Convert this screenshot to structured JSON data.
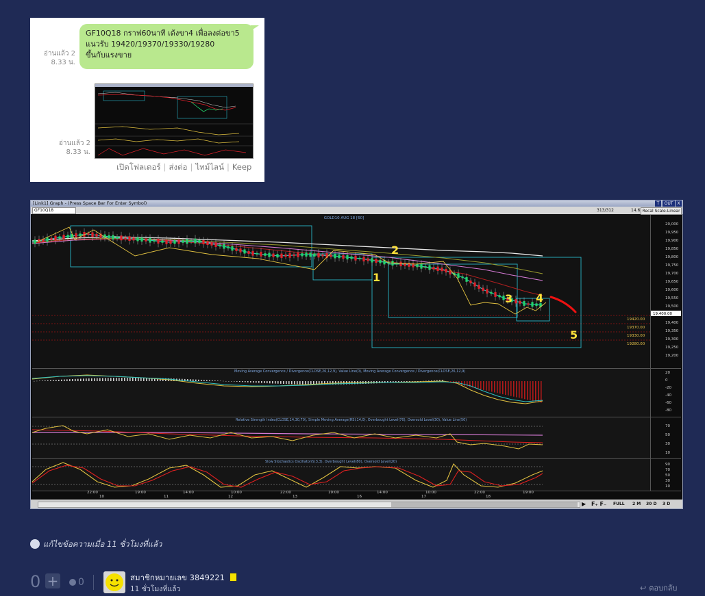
{
  "chat": {
    "message_lines": [
      "GF10Q18 กราฟ60นาที เด้งขา4 เพื่อลงต่อขา5",
      "แนวรับ 19420/19370/19330/19280",
      "ขึ้นกับแรงขาย"
    ],
    "read_1": {
      "label": "อ่านแล้ว 2",
      "time": "8.33 น."
    },
    "read_2": {
      "label": "อ่านแล้ว 2",
      "time": "8.33 น."
    },
    "actions": [
      "เปิดโฟลเดอร์",
      "ส่งต่อ",
      "ไทม์ไลน์",
      "Keep"
    ]
  },
  "trading_window": {
    "title": "[Link1] Graph - (Press Space Bar For Enter Symbol)",
    "window_buttons": [
      "T",
      "OUT",
      "X"
    ],
    "symbol": "GF10Q18",
    "counter": "313/312",
    "value": "14.67",
    "scale_button": "Recal Scale-Linear",
    "chart_title": "GOLD10 AUG 18  [60]",
    "price_axis": [
      "20,000",
      "19,950",
      "19,900",
      "19,850",
      "19,800",
      "19,750",
      "19,700",
      "19,650",
      "19,600",
      "19,550",
      "19,500",
      "19,450",
      "19,400",
      "19,350",
      "19,300",
      "19,250",
      "19,200"
    ],
    "current_price": "19,400.00",
    "support_levels": [
      "19420.00",
      "19370.00",
      "19330.00",
      "19280.00"
    ],
    "wave_labels": [
      "1",
      "2",
      "3",
      "4",
      "5"
    ],
    "macd": {
      "title": "Moving Average Convergence / Divergence(CLOSE,26,12,9), Value Line(0), Moving Average Convergence / Divergence(CLOSE,26,12,9)",
      "axis": [
        "20",
        "0",
        "-20",
        "-40",
        "-60",
        "-80"
      ]
    },
    "rsi": {
      "title": "Relative Strength Index(CLOSE,14,30,70), Simple Moving Average(RSI,14,0), Overbought Level(70), Oversold Level(30), Value Line(50)",
      "axis": [
        "70",
        "50",
        "30",
        "10"
      ]
    },
    "stoch": {
      "title": "Slow Stochastics Oscillator(9,3,3), Overbought Level(80), Oversold Level(20)",
      "axis": [
        "90",
        "70",
        "50",
        "30",
        "10"
      ]
    },
    "time_labels": [
      "22:00",
      "19:00",
      "14:00",
      "10:00",
      "22:00",
      "19:00",
      "14:00",
      "10:00",
      "22:00",
      "19:00"
    ],
    "date_labels": [
      "10",
      "11",
      "12",
      "13",
      "16",
      "17",
      "18"
    ],
    "bottom_buttons": [
      "FULL",
      "2 M",
      "30 D",
      "3 D"
    ],
    "colors": {
      "up": "#22d36b",
      "down": "#e0202a",
      "box": "#2bb7c9",
      "wave_label": "#ffe23a"
    }
  },
  "footer": {
    "edit_note": "แก้ไขข้อความเมื่อ 11 ชั่วโมงที่แล้ว",
    "vote_count": "0",
    "reaction_count": "0",
    "member_name": "สมาชิกหมายเลข 3849221",
    "member_time": "11 ชั่วโมงที่แล้ว",
    "reply_label": "ตอบกลับ"
  }
}
